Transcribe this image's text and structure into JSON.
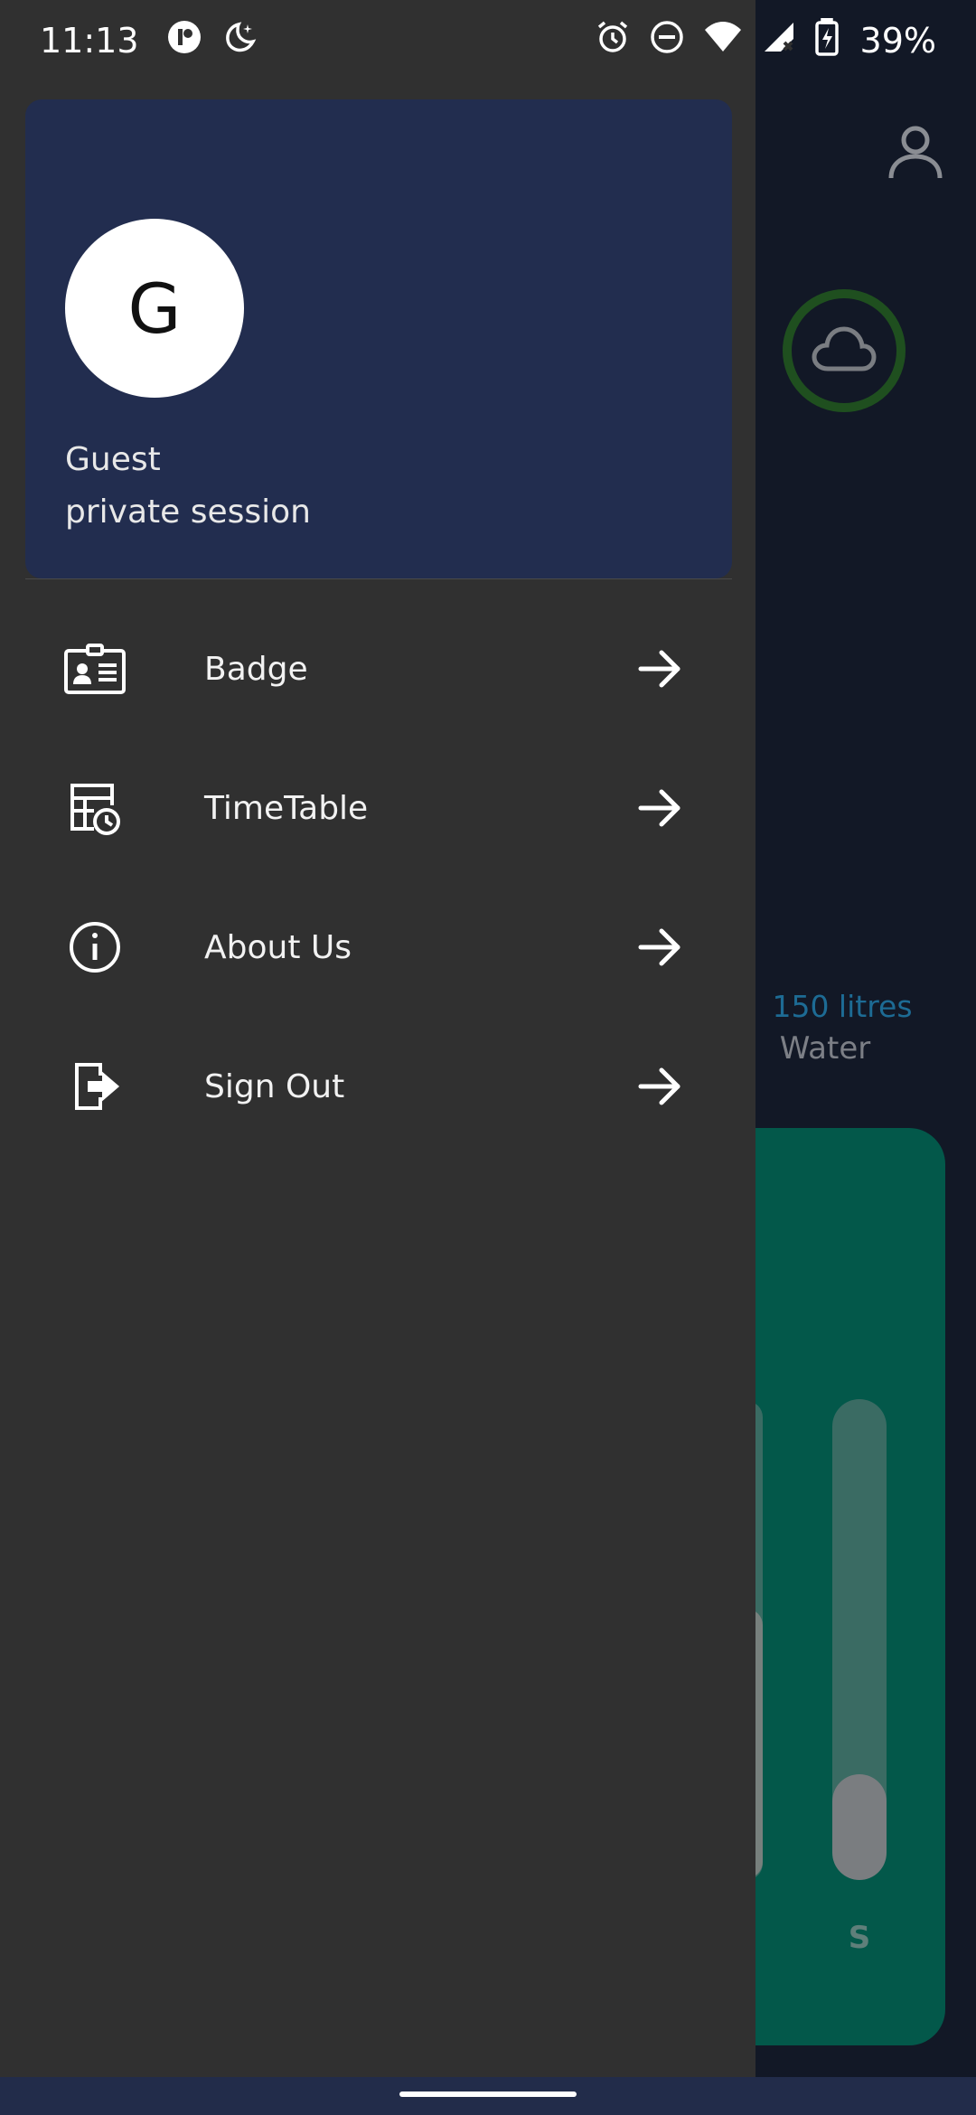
{
  "status_bar": {
    "time": "11:13",
    "battery_percent": "39%",
    "left_icons": [
      "app-notification-icon",
      "bedtime-moon-icon"
    ],
    "right_icons": [
      "alarm-icon",
      "do-not-disturb-icon",
      "wifi-icon",
      "cellular-no-signal-icon",
      "battery-charging-icon"
    ]
  },
  "drawer": {
    "avatar_initial": "G",
    "user_name": "Guest",
    "session_label": "private session",
    "items": [
      {
        "label": "Badge",
        "icon": "badge-card-icon"
      },
      {
        "label": "TimeTable",
        "icon": "timetable-icon"
      },
      {
        "label": "About Us",
        "icon": "info-icon"
      },
      {
        "label": "Sign Out",
        "icon": "sign-out-icon"
      }
    ]
  },
  "background_app": {
    "water_amount": "150 litres",
    "water_label": "Water",
    "bar_letter": "S",
    "bar_level": 0.22
  },
  "colors": {
    "drawer_bg": "#303030",
    "header_bg": "#222d4f",
    "app_bg": "#121826",
    "card_bg": "#03584a",
    "weather_ring": "#1f4f1f",
    "water_amount_text": "#1d6b94"
  }
}
